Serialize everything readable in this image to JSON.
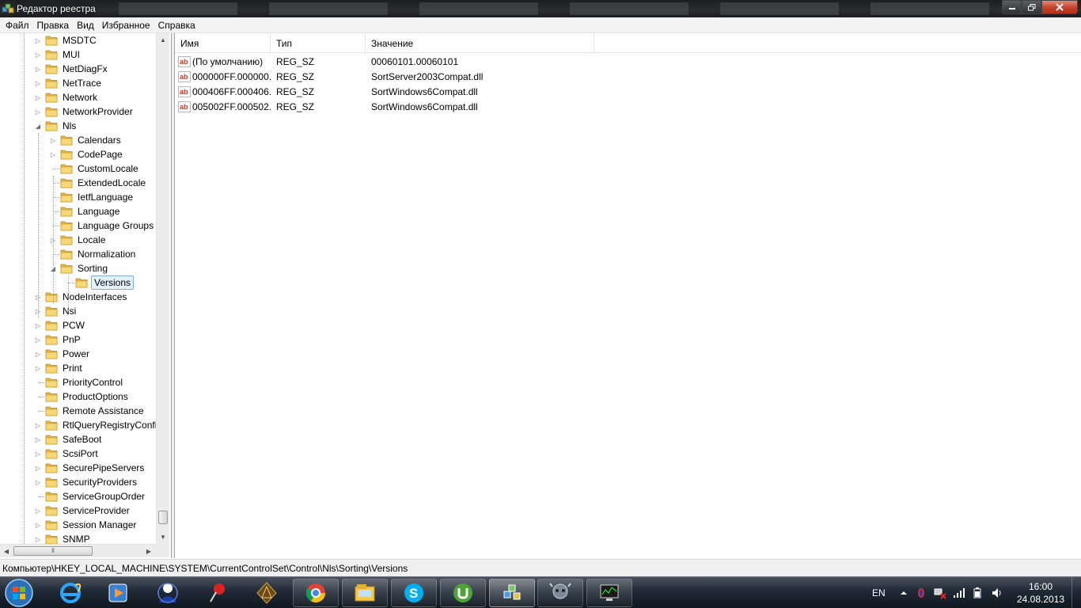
{
  "window": {
    "title": "Редактор реестра"
  },
  "menu": [
    "Файл",
    "Правка",
    "Вид",
    "Избранное",
    "Справка"
  ],
  "tree": [
    {
      "label": "MSDTC",
      "level": 2,
      "expander": "collapsed"
    },
    {
      "label": "MUI",
      "level": 2,
      "expander": "collapsed"
    },
    {
      "label": "NetDiagFx",
      "level": 2,
      "expander": "collapsed"
    },
    {
      "label": "NetTrace",
      "level": 2,
      "expander": "collapsed"
    },
    {
      "label": "Network",
      "level": 2,
      "expander": "collapsed"
    },
    {
      "label": "NetworkProvider",
      "level": 2,
      "expander": "collapsed"
    },
    {
      "label": "Nls",
      "level": 2,
      "expander": "expanded"
    },
    {
      "label": "Calendars",
      "level": 3,
      "expander": "collapsed"
    },
    {
      "label": "CodePage",
      "level": 3,
      "expander": "collapsed"
    },
    {
      "label": "CustomLocale",
      "level": 3,
      "expander": "none"
    },
    {
      "label": "ExtendedLocale",
      "level": 3,
      "expander": "none"
    },
    {
      "label": "IetfLanguage",
      "level": 3,
      "expander": "none"
    },
    {
      "label": "Language",
      "level": 3,
      "expander": "none"
    },
    {
      "label": "Language Groups",
      "level": 3,
      "expander": "none"
    },
    {
      "label": "Locale",
      "level": 3,
      "expander": "collapsed"
    },
    {
      "label": "Normalization",
      "level": 3,
      "expander": "none"
    },
    {
      "label": "Sorting",
      "level": 3,
      "expander": "expanded"
    },
    {
      "label": "Versions",
      "level": 4,
      "expander": "none",
      "selected": true
    },
    {
      "label": "NodeInterfaces",
      "level": 2,
      "expander": "collapsed"
    },
    {
      "label": "Nsi",
      "level": 2,
      "expander": "collapsed"
    },
    {
      "label": "PCW",
      "level": 2,
      "expander": "collapsed"
    },
    {
      "label": "PnP",
      "level": 2,
      "expander": "collapsed"
    },
    {
      "label": "Power",
      "level": 2,
      "expander": "collapsed"
    },
    {
      "label": "Print",
      "level": 2,
      "expander": "collapsed"
    },
    {
      "label": "PriorityControl",
      "level": 2,
      "expander": "none"
    },
    {
      "label": "ProductOptions",
      "level": 2,
      "expander": "none"
    },
    {
      "label": "Remote Assistance",
      "level": 2,
      "expander": "none"
    },
    {
      "label": "RtlQueryRegistryConfig",
      "level": 2,
      "expander": "collapsed"
    },
    {
      "label": "SafeBoot",
      "level": 2,
      "expander": "collapsed"
    },
    {
      "label": "ScsiPort",
      "level": 2,
      "expander": "collapsed"
    },
    {
      "label": "SecurePipeServers",
      "level": 2,
      "expander": "collapsed"
    },
    {
      "label": "SecurityProviders",
      "level": 2,
      "expander": "collapsed"
    },
    {
      "label": "ServiceGroupOrder",
      "level": 2,
      "expander": "none"
    },
    {
      "label": "ServiceProvider",
      "level": 2,
      "expander": "collapsed"
    },
    {
      "label": "Session Manager",
      "level": 2,
      "expander": "collapsed"
    },
    {
      "label": "SNMP",
      "level": 2,
      "expander": "collapsed"
    }
  ],
  "list": {
    "columns": [
      "Имя",
      "Тип",
      "Значение"
    ],
    "rows": [
      {
        "name": "(По умолчанию)",
        "type": "REG_SZ",
        "value": "00060101.00060101"
      },
      {
        "name": "000000FF.000000...",
        "type": "REG_SZ",
        "value": "SortServer2003Compat.dll"
      },
      {
        "name": "000406FF.000406...",
        "type": "REG_SZ",
        "value": "SortWindows6Compat.dll"
      },
      {
        "name": "005002FF.000502...",
        "type": "REG_SZ",
        "value": "SortWindows6Compat.dll"
      }
    ]
  },
  "status": "Компьютер\\HKEY_LOCAL_MACHINE\\SYSTEM\\CurrentControlSet\\Control\\Nls\\Sorting\\Versions",
  "taskbar": {
    "apps": [
      "internet-explorer",
      "media-player",
      "user-app",
      "pin-app",
      "game-emblem",
      "chrome",
      "file-explorer",
      "skype",
      "utorrent",
      "registry-editor",
      "game-skull",
      "task-manager"
    ],
    "tray": {
      "lang": "EN",
      "time": "16:00",
      "date": "24.08.2013"
    }
  },
  "colors": {
    "selection": "#e4f0fb",
    "selectionBorder": "#84acdd",
    "folder": "#f3cf6a"
  }
}
